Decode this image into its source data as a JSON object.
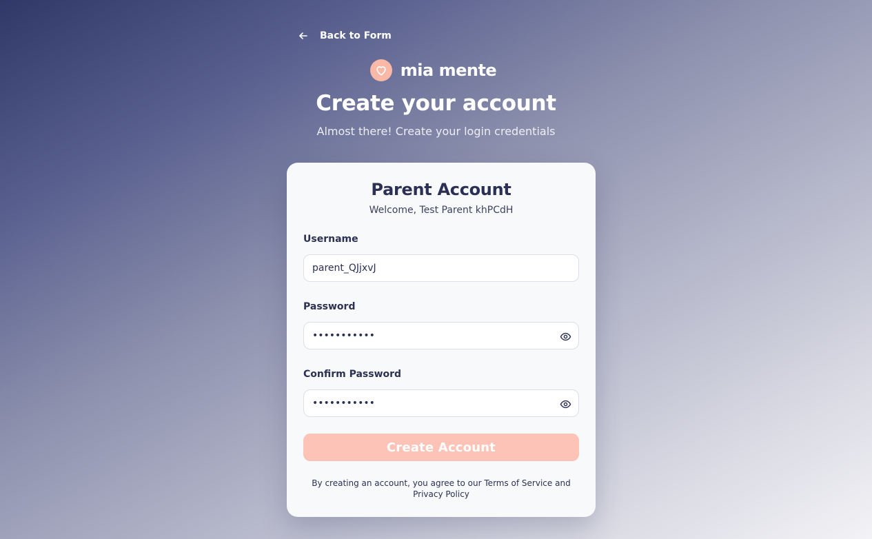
{
  "nav": {
    "back_label": "Back to Form"
  },
  "brand": {
    "name": "mia mente",
    "badge_color": "#f9b9a6"
  },
  "header": {
    "title": "Create your account",
    "subtitle": "Almost there! Create your login credentials"
  },
  "card": {
    "title": "Parent Account",
    "welcome": "Welcome, Test Parent khPCdH",
    "username": {
      "label": "Username",
      "value": "parent_QJjxvJ"
    },
    "password": {
      "label": "Password",
      "value": "•••••••••••",
      "icon": "eye-icon"
    },
    "confirm_password": {
      "label": "Confirm Password",
      "value": "•••••••••••",
      "icon": "eye-icon"
    },
    "submit_label": "Create Account",
    "submit_color": "#fcc3b6",
    "terms": {
      "prefix": "By creating an account, you agree to our",
      "terms_link": "Terms of Service",
      "conjunction": "and",
      "privacy_link": "Privacy Policy"
    }
  }
}
